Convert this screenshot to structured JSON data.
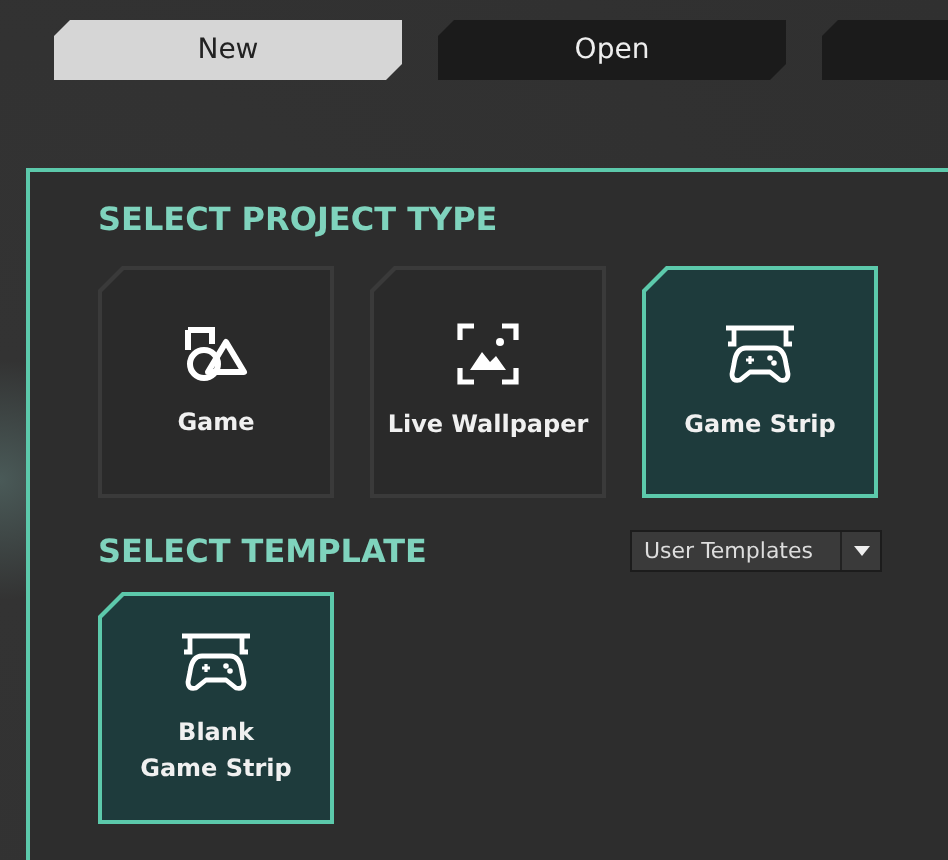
{
  "tabs": [
    {
      "label": "New",
      "selected": true
    },
    {
      "label": "Open",
      "selected": false
    },
    {
      "selected": false
    }
  ],
  "project_types": {
    "heading": "SELECT PROJECT TYPE",
    "items": [
      {
        "label": "Game",
        "kind": "game",
        "selected": false
      },
      {
        "label": "Live Wallpaper",
        "kind": "wallpaper",
        "selected": false
      },
      {
        "label": "Game Strip",
        "kind": "strip",
        "selected": true
      }
    ]
  },
  "templates": {
    "heading": "SELECT TEMPLATE",
    "filter": {
      "value": "User Templates"
    },
    "items": [
      {
        "label": "Blank\nGame Strip",
        "kind": "strip",
        "selected": true
      }
    ]
  }
}
